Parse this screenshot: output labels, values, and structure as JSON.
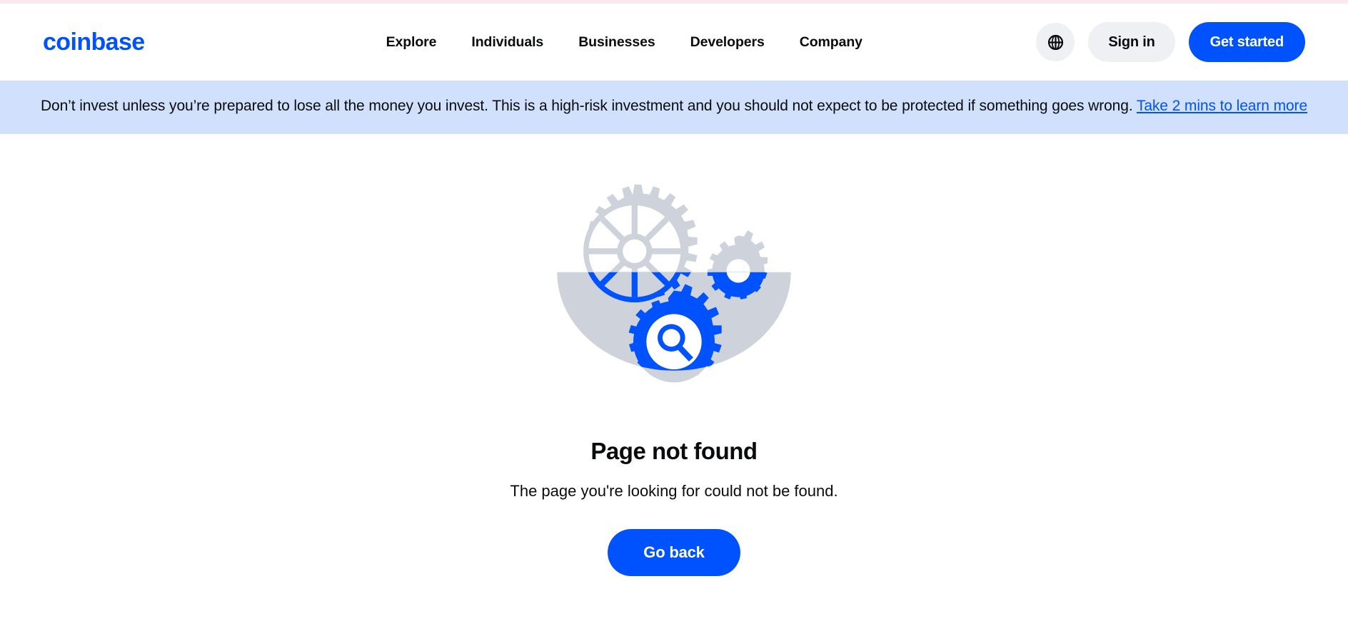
{
  "header": {
    "logo": "coinbase",
    "nav": [
      {
        "label": "Explore"
      },
      {
        "label": "Individuals"
      },
      {
        "label": "Businesses"
      },
      {
        "label": "Developers"
      },
      {
        "label": "Company"
      }
    ],
    "language_icon": "globe-icon",
    "sign_in_label": "Sign in",
    "get_started_label": "Get started"
  },
  "risk_banner": {
    "text": "Don’t invest unless you’re prepared to lose all the money you invest. This is a high-risk investment and you should not expect to be protected if something goes wrong. ",
    "link_label": "Take 2 mins to learn more"
  },
  "error_page": {
    "illustration_name": "broken-gears-magnifier-illustration",
    "title": "Page not found",
    "description": "The page you're looking for could not be found.",
    "go_back_label": "Go back"
  },
  "colors": {
    "brand_blue": "#0052ff",
    "banner_bg": "#d1e0fd",
    "gear_gray": "#ced3db",
    "pill_gray": "#eef0f3",
    "text_dark": "#0a0b0d",
    "top_hairline": "#fae8ee"
  }
}
